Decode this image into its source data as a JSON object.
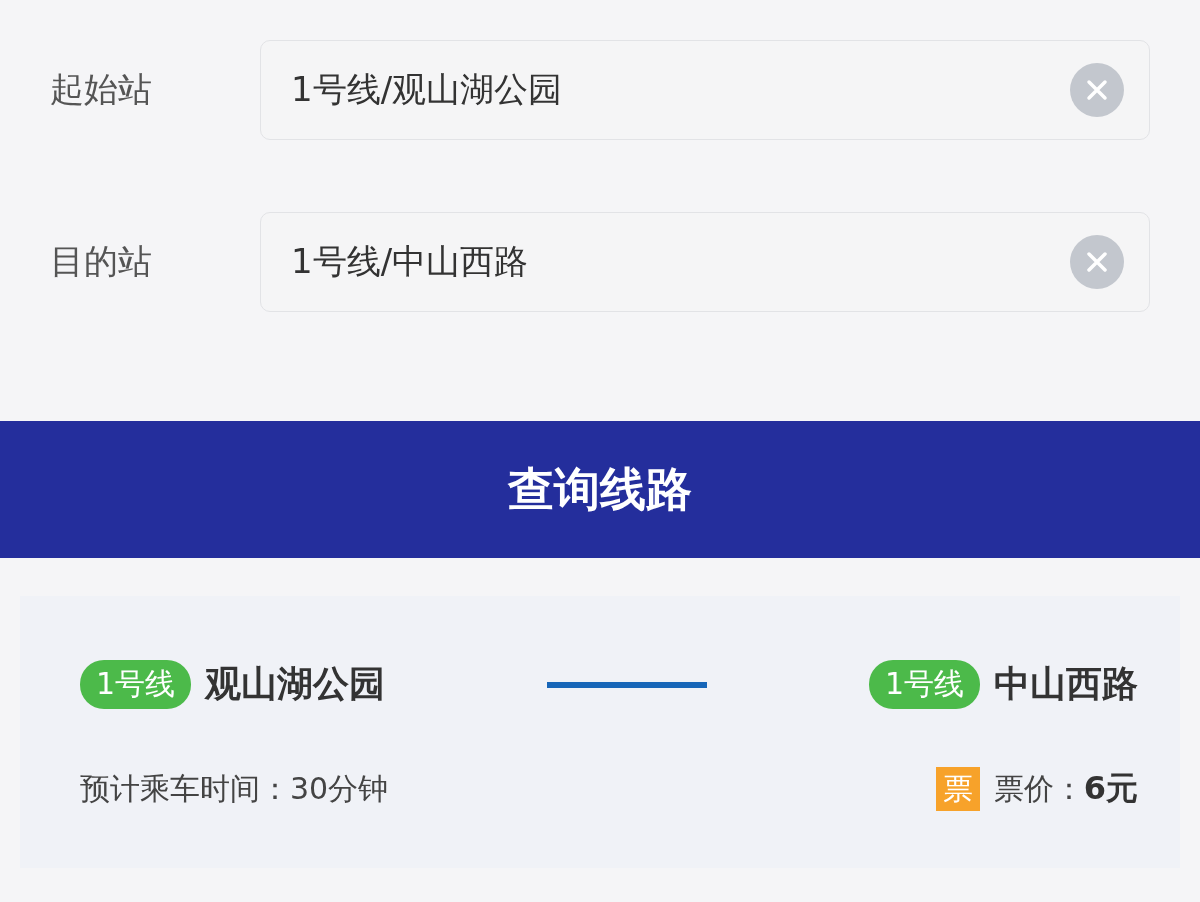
{
  "form": {
    "fields": [
      {
        "label": "起始站",
        "value": "1号线/观山湖公园"
      },
      {
        "label": "目的站",
        "value": "1号线/中山西路"
      }
    ]
  },
  "search_button": "查询线路",
  "result": {
    "from": {
      "line": "1号线",
      "station": "观山湖公园"
    },
    "to": {
      "line": "1号线",
      "station": "中山西路"
    },
    "travel_time": "预计乘车时间：30分钟",
    "ticket_icon": "票",
    "fare_label": "票价：",
    "fare": "6元"
  }
}
